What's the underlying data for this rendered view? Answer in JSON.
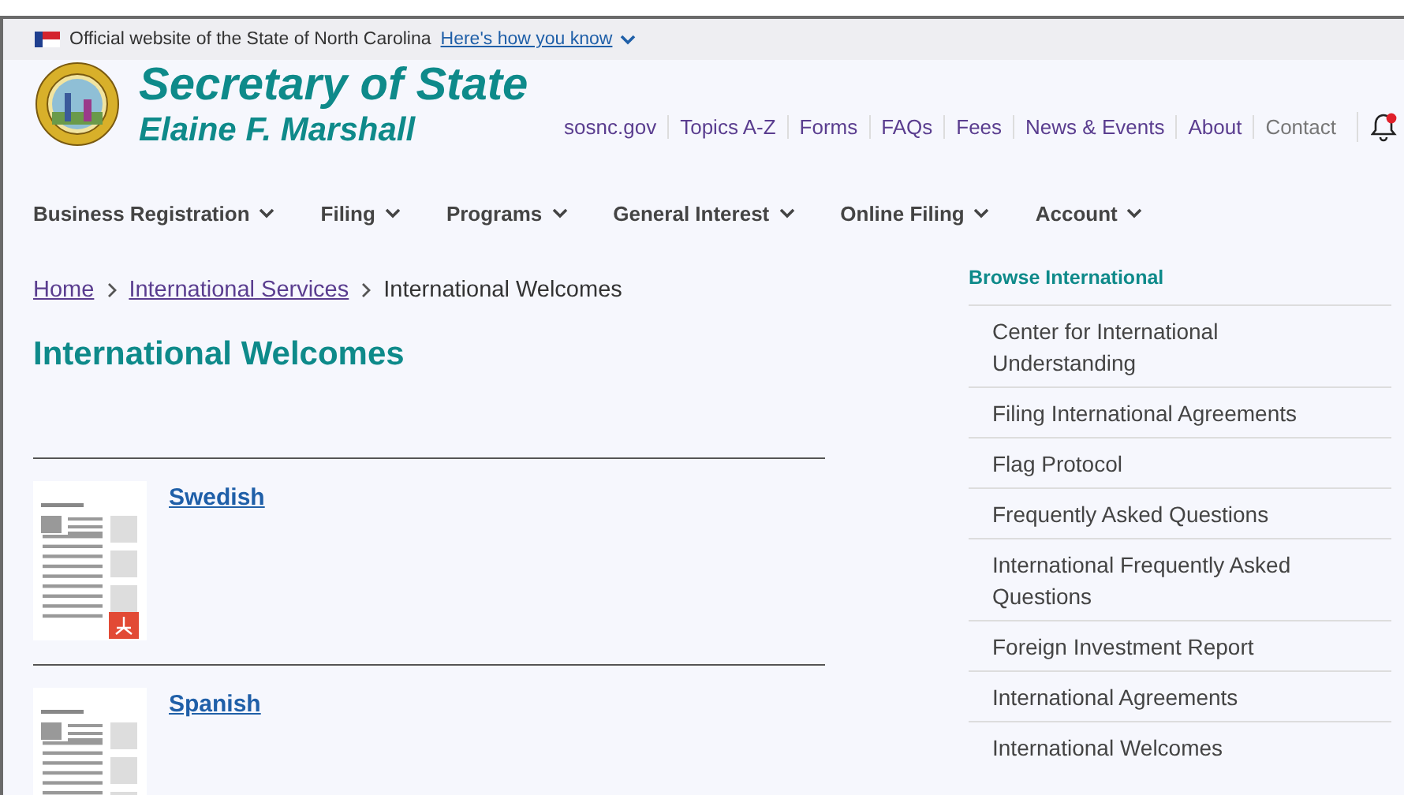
{
  "gov_banner": {
    "text": "Official website of the State of North Carolina",
    "link": "Here's how you know"
  },
  "header": {
    "title": "Secretary of State",
    "subtitle": "Elaine F. Marshall",
    "utility_links": [
      {
        "label": "sosnc.gov",
        "dimmed": false
      },
      {
        "label": "Topics A-Z",
        "dimmed": false
      },
      {
        "label": "Forms",
        "dimmed": false
      },
      {
        "label": "FAQs",
        "dimmed": false
      },
      {
        "label": "Fees",
        "dimmed": false
      },
      {
        "label": "News & Events",
        "dimmed": false
      },
      {
        "label": "About",
        "dimmed": false
      },
      {
        "label": "Contact",
        "dimmed": true
      }
    ],
    "notification": true
  },
  "main_nav": [
    "Business Registration",
    "Filing",
    "Programs",
    "General Interest",
    "Online Filing",
    "Account"
  ],
  "breadcrumb": [
    "Home",
    "International Services",
    "International Welcomes"
  ],
  "page_title": "International Welcomes",
  "documents": [
    {
      "title": "Swedish",
      "pdf": true
    },
    {
      "title": "Spanish"
    }
  ],
  "sidebar": {
    "heading": "Browse International",
    "items": [
      "Center for International Understanding",
      "Filing International Agreements",
      "Flag Protocol",
      "Frequently Asked Questions",
      "International Frequently Asked Questions",
      "Foreign Investment Report",
      "International Agreements",
      "International Welcomes"
    ]
  }
}
